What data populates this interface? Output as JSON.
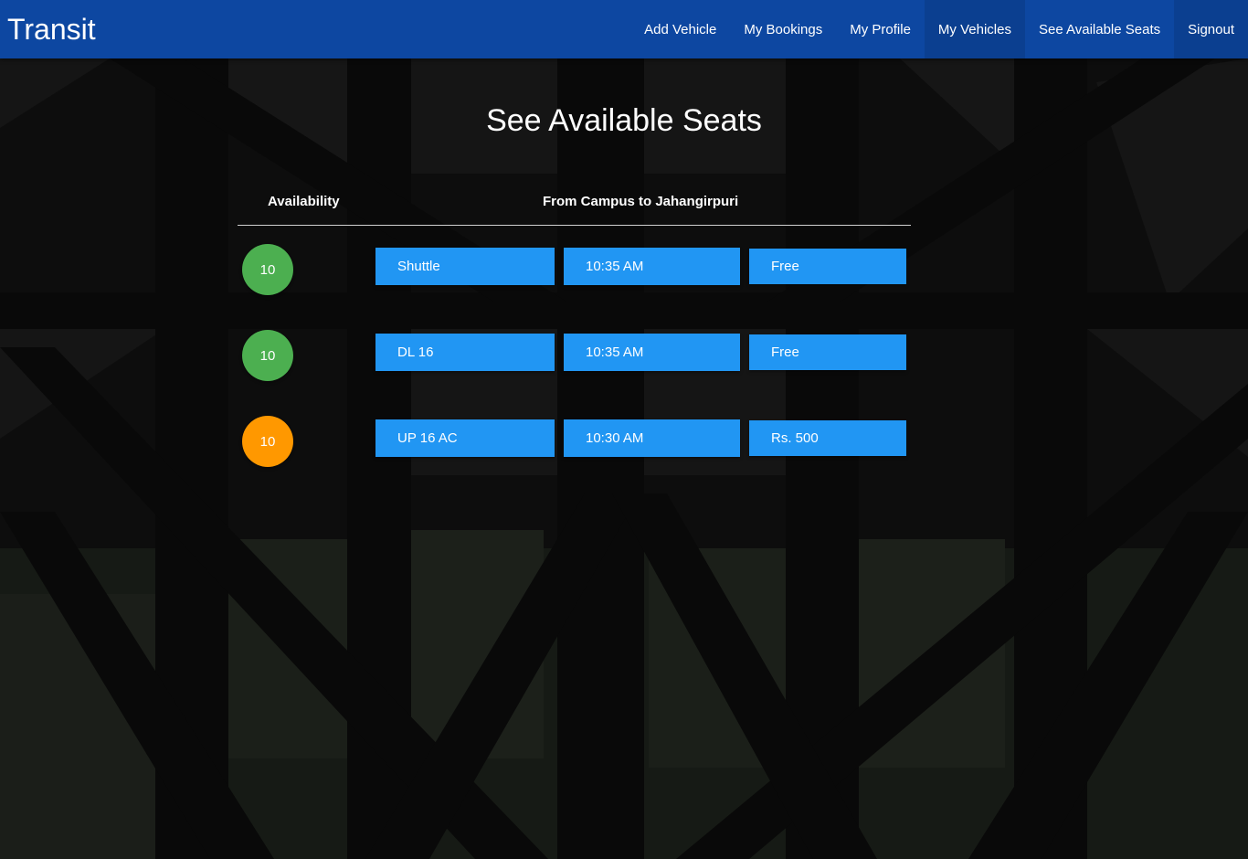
{
  "app": {
    "brand": "Transit"
  },
  "nav": {
    "items": [
      {
        "label": "Add Vehicle",
        "active": false
      },
      {
        "label": "My Bookings",
        "active": false
      },
      {
        "label": "My Profile",
        "active": false
      },
      {
        "label": "My Vehicles",
        "active": true
      },
      {
        "label": "See Available Seats",
        "active": false
      },
      {
        "label": "Signout",
        "active": true
      }
    ]
  },
  "page": {
    "title": "See Available Seats"
  },
  "table": {
    "headers": {
      "availability": "Availability",
      "route": "From Campus to Jahangirpuri"
    },
    "rows": [
      {
        "seats": "10",
        "seat_color": "#4caf50",
        "vehicle": "Shuttle",
        "time": "10:35 AM",
        "fare": "Free"
      },
      {
        "seats": "10",
        "seat_color": "#4caf50",
        "vehicle": "DL 16",
        "time": "10:35 AM",
        "fare": "Free"
      },
      {
        "seats": "10",
        "seat_color": "#ff9800",
        "vehicle": "UP 16 AC",
        "time": "10:30 AM",
        "fare": "Rs. 500"
      }
    ]
  },
  "colors": {
    "navbar": "#0d47a1",
    "cell": "#2196f3",
    "available_high": "#4caf50",
    "available_mid": "#ff9800"
  }
}
